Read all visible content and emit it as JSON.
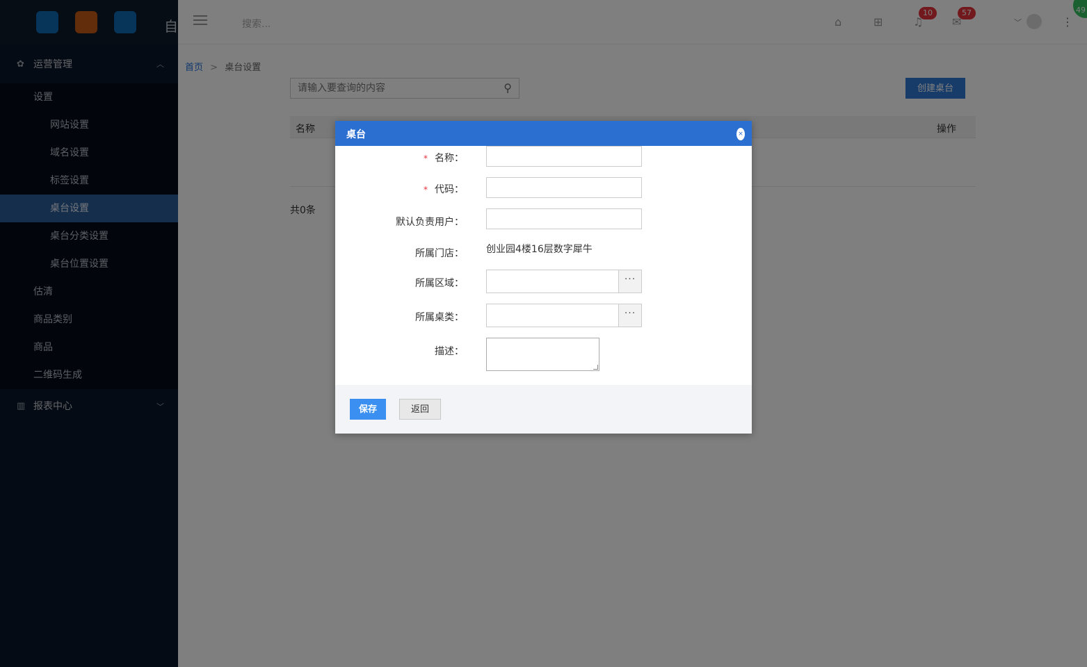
{
  "sidebar": {
    "logo_char": "自",
    "logo_colors": [
      "#0f6ab4",
      "#c25a15",
      "#0f6ab4"
    ],
    "group1": {
      "label": "运营管理",
      "icon": "cluster-icon"
    },
    "settings_label": "设置",
    "settings_items": [
      {
        "label": "网站设置"
      },
      {
        "label": "域名设置"
      },
      {
        "label": "标签设置"
      },
      {
        "label": "桌台设置"
      },
      {
        "label": "桌台分类设置"
      },
      {
        "label": "桌台位置设置"
      }
    ],
    "other_items": [
      {
        "label": "估清"
      },
      {
        "label": "商品类别"
      },
      {
        "label": "商品"
      },
      {
        "label": "二维码生成"
      }
    ],
    "group2": {
      "label": "报表中心",
      "icon": "bar-chart-icon"
    }
  },
  "topbar": {
    "search_placeholder": "搜索...",
    "notifications_count": "10",
    "messages_count": "57",
    "corner_badge": "49"
  },
  "breadcrumb": {
    "home": "首页",
    "separator": ">",
    "current": "桌台设置"
  },
  "toolbar": {
    "search_placeholder": "请输入要查询的内容",
    "create_label": "创建桌台"
  },
  "table": {
    "col_name": "名称",
    "col_action": "操作",
    "total": "共0条"
  },
  "modal": {
    "title": "桌台",
    "close_glyph": "×",
    "fields": {
      "name_label": "名称：",
      "code_label": "代码：",
      "required_mark": "*",
      "default_user_label": "默认负责用户：",
      "store_label": "所属门店：",
      "store_value": "创业园4楼16层数字犀牛",
      "area_label": "所属区域：",
      "category_label": "所属桌类：",
      "picker_glyph": "···",
      "desc_label": "描述："
    },
    "save_label": "保存",
    "back_label": "返回"
  },
  "colors": {
    "modal_header": "#2b6fd1",
    "active_menu": "#2a5d97",
    "save_button": "#3a8ff0",
    "badge": "#e5323d"
  }
}
